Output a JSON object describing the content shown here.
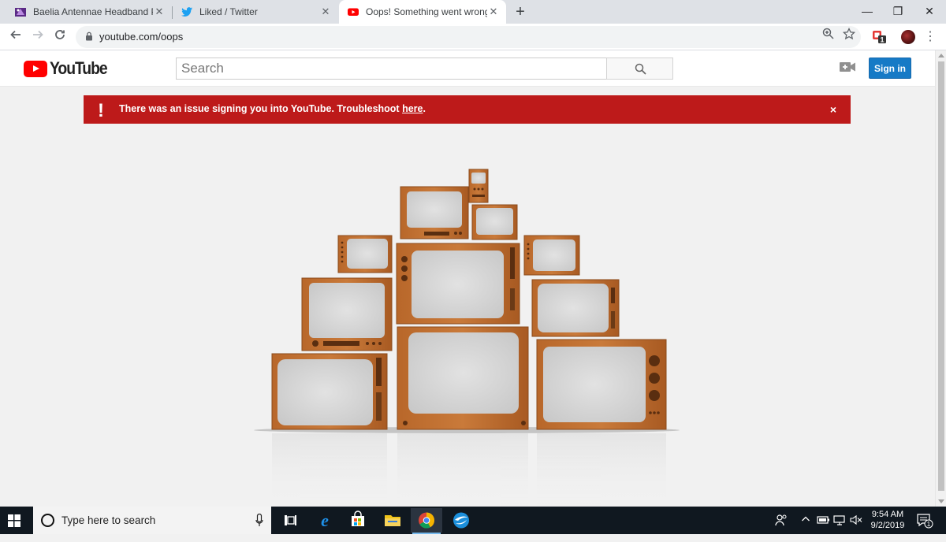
{
  "browser": {
    "tabs": [
      {
        "title": "Baelia Antennae Headband Previ",
        "active": false
      },
      {
        "title": "Liked / Twitter",
        "active": false
      },
      {
        "title": "Oops! Something went wrong. -",
        "active": true
      }
    ],
    "url": "youtube.com/oops",
    "window_controls": {
      "minimize": "—",
      "restore": "❐",
      "close": "✕"
    },
    "extension_badge": "1"
  },
  "youtube": {
    "logo_text": "YouTube",
    "search_placeholder": "Search",
    "signin_label": "Sign in",
    "alert": {
      "icon": "!",
      "message_prefix": "There was an issue signing you into YouTube. Troubleshoot ",
      "link_text": "here",
      "message_suffix": ".",
      "close": "×"
    }
  },
  "taskbar": {
    "search_placeholder": "Type here to search",
    "time": "9:54 AM",
    "date": "9/2/2019",
    "notification_count": "1"
  }
}
